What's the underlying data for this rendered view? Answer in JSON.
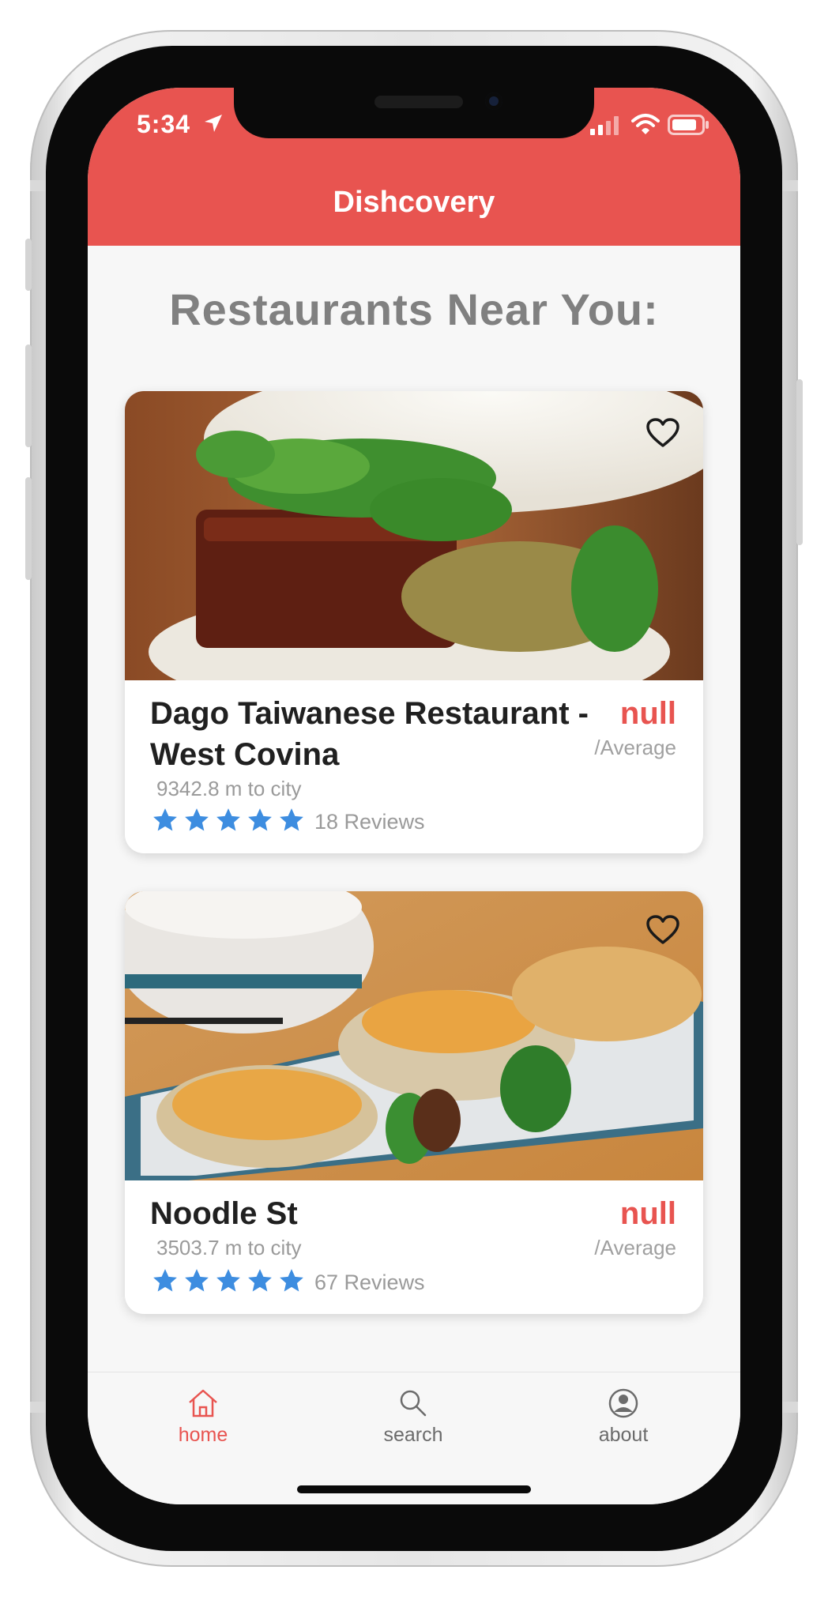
{
  "status_bar": {
    "time": "5:34"
  },
  "header": {
    "title": "Dishcovery",
    "color": "#e85450"
  },
  "section": {
    "title": "Restaurants Near You:"
  },
  "restaurants": [
    {
      "name": "Dago Taiwanese Restaurant - West Covina",
      "price": "null",
      "avg_label": "/Average",
      "distance": "9342.8 m to city",
      "rating": 5,
      "reviews": "18 Reviews",
      "image": "gua-bao-pork-belly-bun"
    },
    {
      "name": "Noodle St",
      "price": "null",
      "avg_label": "/Average",
      "distance": "3503.7 m to city",
      "rating": 5,
      "reviews": "67 Reviews",
      "image": "scallion-pancake-rolls"
    }
  ],
  "tabbar": {
    "items": [
      {
        "label": "home",
        "icon": "home-icon",
        "active": true
      },
      {
        "label": "search",
        "icon": "search-icon",
        "active": false
      },
      {
        "label": "about",
        "icon": "user-icon",
        "active": false
      }
    ],
    "active_color": "#e85450",
    "inactive_color": "#6b6b6b"
  },
  "colors": {
    "star": "#3d8de0",
    "accent": "#e85450"
  }
}
